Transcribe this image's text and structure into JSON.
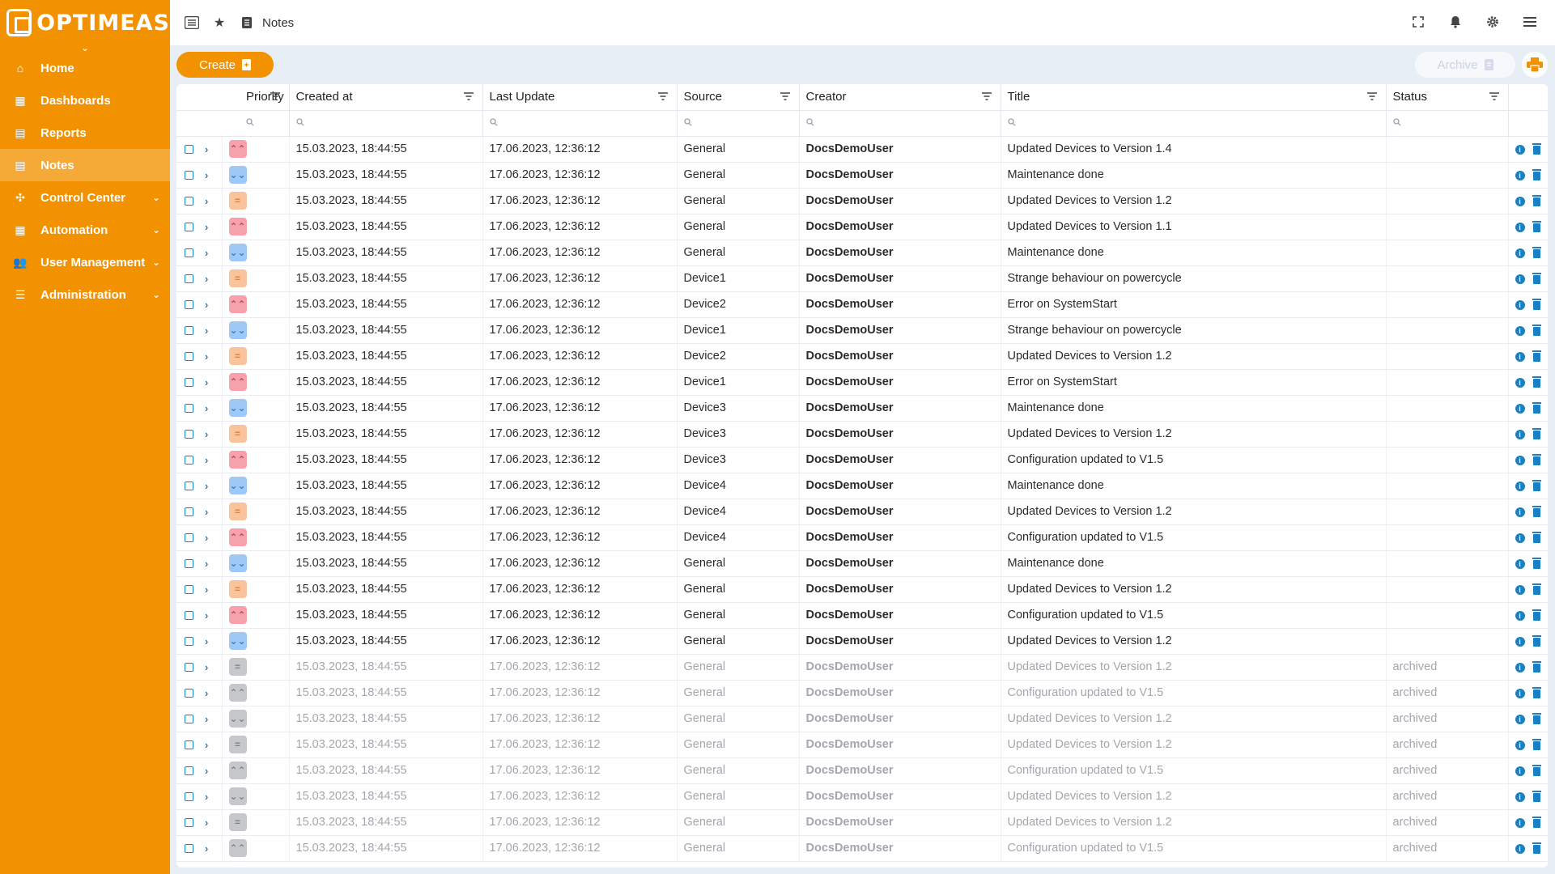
{
  "brand": {
    "name": "OPTIMEAS"
  },
  "sidebar": {
    "items": [
      {
        "label": "Home",
        "icon": "home-icon",
        "active": false,
        "expandable": false
      },
      {
        "label": "Dashboards",
        "icon": "dashboard-icon",
        "active": false,
        "expandable": false
      },
      {
        "label": "Reports",
        "icon": "report-icon",
        "active": false,
        "expandable": false
      },
      {
        "label": "Notes",
        "icon": "notes-icon",
        "active": true,
        "expandable": false
      },
      {
        "label": "Control Center",
        "icon": "control-center-icon",
        "active": false,
        "expandable": true
      },
      {
        "label": "Automation",
        "icon": "automation-icon",
        "active": false,
        "expandable": true
      },
      {
        "label": "User Management",
        "icon": "users-icon",
        "active": false,
        "expandable": true
      },
      {
        "label": "Administration",
        "icon": "administration-icon",
        "active": false,
        "expandable": true
      }
    ]
  },
  "topbar": {
    "title": "Notes"
  },
  "toolbar": {
    "create_label": "Create",
    "archive_label": "Archive"
  },
  "table": {
    "columns": [
      "Priority",
      "Created at",
      "Last Update",
      "Source",
      "Creator",
      "Title",
      "Status"
    ],
    "rows": [
      {
        "priority": "high",
        "created": "15.03.2023, 18:44:55",
        "updated": "17.06.2023, 12:36:12",
        "source": "General",
        "creator": "DocsDemoUser",
        "title": "Updated Devices to Version 1.4",
        "status": ""
      },
      {
        "priority": "low",
        "created": "15.03.2023, 18:44:55",
        "updated": "17.06.2023, 12:36:12",
        "source": "General",
        "creator": "DocsDemoUser",
        "title": "Maintenance done",
        "status": ""
      },
      {
        "priority": "medium",
        "created": "15.03.2023, 18:44:55",
        "updated": "17.06.2023, 12:36:12",
        "source": "General",
        "creator": "DocsDemoUser",
        "title": "Updated Devices to Version 1.2",
        "status": ""
      },
      {
        "priority": "high",
        "created": "15.03.2023, 18:44:55",
        "updated": "17.06.2023, 12:36:12",
        "source": "General",
        "creator": "DocsDemoUser",
        "title": "Updated Devices to Version 1.1",
        "status": ""
      },
      {
        "priority": "low",
        "created": "15.03.2023, 18:44:55",
        "updated": "17.06.2023, 12:36:12",
        "source": "General",
        "creator": "DocsDemoUser",
        "title": "Maintenance done",
        "status": ""
      },
      {
        "priority": "medium",
        "created": "15.03.2023, 18:44:55",
        "updated": "17.06.2023, 12:36:12",
        "source": "Device1",
        "creator": "DocsDemoUser",
        "title": "Strange behaviour on powercycle",
        "status": ""
      },
      {
        "priority": "high",
        "created": "15.03.2023, 18:44:55",
        "updated": "17.06.2023, 12:36:12",
        "source": "Device2",
        "creator": "DocsDemoUser",
        "title": "Error on SystemStart",
        "status": ""
      },
      {
        "priority": "low",
        "created": "15.03.2023, 18:44:55",
        "updated": "17.06.2023, 12:36:12",
        "source": "Device1",
        "creator": "DocsDemoUser",
        "title": "Strange behaviour on powercycle",
        "status": ""
      },
      {
        "priority": "medium",
        "created": "15.03.2023, 18:44:55",
        "updated": "17.06.2023, 12:36:12",
        "source": "Device2",
        "creator": "DocsDemoUser",
        "title": "Updated Devices to Version 1.2",
        "status": ""
      },
      {
        "priority": "high",
        "created": "15.03.2023, 18:44:55",
        "updated": "17.06.2023, 12:36:12",
        "source": "Device1",
        "creator": "DocsDemoUser",
        "title": "Error on SystemStart",
        "status": ""
      },
      {
        "priority": "low",
        "created": "15.03.2023, 18:44:55",
        "updated": "17.06.2023, 12:36:12",
        "source": "Device3",
        "creator": "DocsDemoUser",
        "title": "Maintenance done",
        "status": ""
      },
      {
        "priority": "medium",
        "created": "15.03.2023, 18:44:55",
        "updated": "17.06.2023, 12:36:12",
        "source": "Device3",
        "creator": "DocsDemoUser",
        "title": "Updated Devices to Version 1.2",
        "status": ""
      },
      {
        "priority": "high",
        "created": "15.03.2023, 18:44:55",
        "updated": "17.06.2023, 12:36:12",
        "source": "Device3",
        "creator": "DocsDemoUser",
        "title": "Configuration updated to V1.5",
        "status": ""
      },
      {
        "priority": "low",
        "created": "15.03.2023, 18:44:55",
        "updated": "17.06.2023, 12:36:12",
        "source": "Device4",
        "creator": "DocsDemoUser",
        "title": "Maintenance done",
        "status": ""
      },
      {
        "priority": "medium",
        "created": "15.03.2023, 18:44:55",
        "updated": "17.06.2023, 12:36:12",
        "source": "Device4",
        "creator": "DocsDemoUser",
        "title": "Updated Devices to Version 1.2",
        "status": ""
      },
      {
        "priority": "high",
        "created": "15.03.2023, 18:44:55",
        "updated": "17.06.2023, 12:36:12",
        "source": "Device4",
        "creator": "DocsDemoUser",
        "title": "Configuration updated to V1.5",
        "status": ""
      },
      {
        "priority": "low",
        "created": "15.03.2023, 18:44:55",
        "updated": "17.06.2023, 12:36:12",
        "source": "General",
        "creator": "DocsDemoUser",
        "title": "Maintenance done",
        "status": ""
      },
      {
        "priority": "medium",
        "created": "15.03.2023, 18:44:55",
        "updated": "17.06.2023, 12:36:12",
        "source": "General",
        "creator": "DocsDemoUser",
        "title": "Updated Devices to Version 1.2",
        "status": ""
      },
      {
        "priority": "high",
        "created": "15.03.2023, 18:44:55",
        "updated": "17.06.2023, 12:36:12",
        "source": "General",
        "creator": "DocsDemoUser",
        "title": "Configuration updated to V1.5",
        "status": ""
      },
      {
        "priority": "low",
        "created": "15.03.2023, 18:44:55",
        "updated": "17.06.2023, 12:36:12",
        "source": "General",
        "creator": "DocsDemoUser",
        "title": "Updated Devices to Version 1.2",
        "status": ""
      },
      {
        "priority": "medium",
        "archived": true,
        "created": "15.03.2023, 18:44:55",
        "updated": "17.06.2023, 12:36:12",
        "source": "General",
        "creator": "DocsDemoUser",
        "title": "Updated Devices to Version 1.2",
        "status": "archived"
      },
      {
        "priority": "high",
        "archived": true,
        "created": "15.03.2023, 18:44:55",
        "updated": "17.06.2023, 12:36:12",
        "source": "General",
        "creator": "DocsDemoUser",
        "title": "Configuration updated to V1.5",
        "status": "archived"
      },
      {
        "priority": "low",
        "archived": true,
        "created": "15.03.2023, 18:44:55",
        "updated": "17.06.2023, 12:36:12",
        "source": "General",
        "creator": "DocsDemoUser",
        "title": "Updated Devices to Version 1.2",
        "status": "archived"
      },
      {
        "priority": "medium",
        "archived": true,
        "created": "15.03.2023, 18:44:55",
        "updated": "17.06.2023, 12:36:12",
        "source": "General",
        "creator": "DocsDemoUser",
        "title": "Updated Devices to Version 1.2",
        "status": "archived"
      },
      {
        "priority": "high",
        "archived": true,
        "created": "15.03.2023, 18:44:55",
        "updated": "17.06.2023, 12:36:12",
        "source": "General",
        "creator": "DocsDemoUser",
        "title": "Configuration updated to V1.5",
        "status": "archived"
      },
      {
        "priority": "low",
        "archived": true,
        "created": "15.03.2023, 18:44:55",
        "updated": "17.06.2023, 12:36:12",
        "source": "General",
        "creator": "DocsDemoUser",
        "title": "Updated Devices to Version 1.2",
        "status": "archived"
      },
      {
        "priority": "medium",
        "archived": true,
        "created": "15.03.2023, 18:44:55",
        "updated": "17.06.2023, 12:36:12",
        "source": "General",
        "creator": "DocsDemoUser",
        "title": "Updated Devices to Version 1.2",
        "status": "archived"
      },
      {
        "priority": "high",
        "archived": true,
        "created": "15.03.2023, 18:44:55",
        "updated": "17.06.2023, 12:36:12",
        "source": "General",
        "creator": "DocsDemoUser",
        "title": "Configuration updated to V1.5",
        "status": "archived"
      }
    ]
  },
  "colors": {
    "brand": "#f39200",
    "accent_blue": "#1b7fc2",
    "prio_high": "#f6a2ad",
    "prio_low": "#9fc8f6",
    "prio_medium": "#f9c49c",
    "prio_archived": "#c6c8cb"
  }
}
